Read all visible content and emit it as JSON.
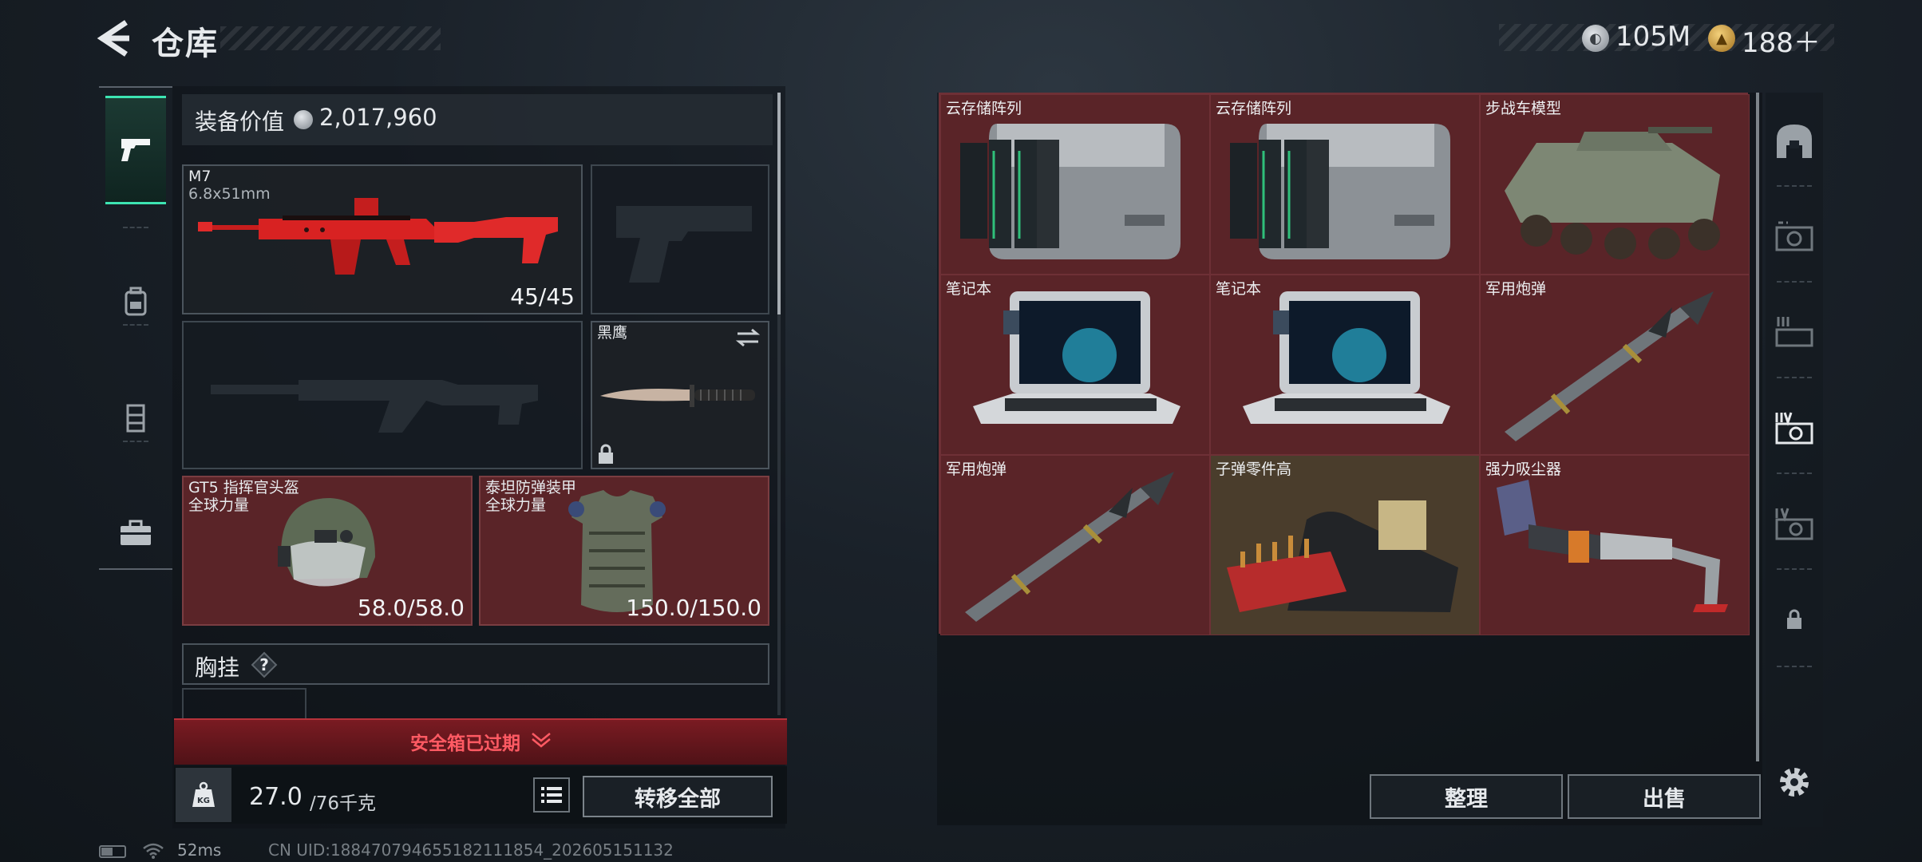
{
  "header": {
    "title": "仓库",
    "coins": "105M",
    "coins_icon": "silver-coin-icon",
    "premium": "188＋",
    "premium_icon": "gold-coin-icon"
  },
  "left_tabs": [
    {
      "name": "pistol-icon",
      "active": true
    },
    {
      "name": "backpack-icon",
      "active": false
    },
    {
      "name": "chest-rig-icon",
      "active": false
    },
    {
      "name": "briefcase-icon",
      "active": false
    }
  ],
  "equipment": {
    "value_label": "装备价值",
    "value": "2,017,960",
    "primary": {
      "name": "M7",
      "caliber": "6.8x51mm",
      "ammo": "45/45"
    },
    "melee": {
      "name": "黑鹰"
    },
    "helmet": {
      "name": "GT5 指挥官头盔",
      "faction": "全球力量",
      "durability": "58.0/58.0"
    },
    "armor": {
      "name": "泰坦防弹装甲",
      "faction": "全球力量",
      "durability": "150.0/150.0"
    },
    "chest_label": "胸挂",
    "chest_help": "?",
    "safebox_expired": "安全箱已过期",
    "weight_current": "27.0",
    "weight_max": "/76千克",
    "kg_label": "KG",
    "transfer_all": "转移全部"
  },
  "storage": {
    "items": [
      {
        "name": "云存储阵列",
        "art": "server"
      },
      {
        "name": "云存储阵列",
        "art": "server"
      },
      {
        "name": "步战车模型",
        "art": "vehicle"
      },
      {
        "name": "笔记本",
        "art": "laptop"
      },
      {
        "name": "笔记本",
        "art": "laptop"
      },
      {
        "name": "军用炮弹",
        "art": "missile"
      },
      {
        "name": "军用炮弹",
        "art": "missile"
      },
      {
        "name": "子弹零件高",
        "art": "ammo-crate"
      },
      {
        "name": "强力吸尘器",
        "art": "vacuum"
      }
    ],
    "sort_label": "整理",
    "sell_label": "出售"
  },
  "right_tabs": [
    "storage-all-icon",
    "storage-2-icon",
    "storage-3-icon",
    "storage-4-icon",
    "storage-5-icon",
    "locked-storage-icon",
    "settings-gear-icon"
  ],
  "status": {
    "ping": "52ms",
    "uid": "CN UID:1884707946551821118​54_202605151132"
  },
  "colors": {
    "accent": "#3de4b2",
    "item_red": "#5a2428",
    "warning_red": "#ff5a63"
  }
}
